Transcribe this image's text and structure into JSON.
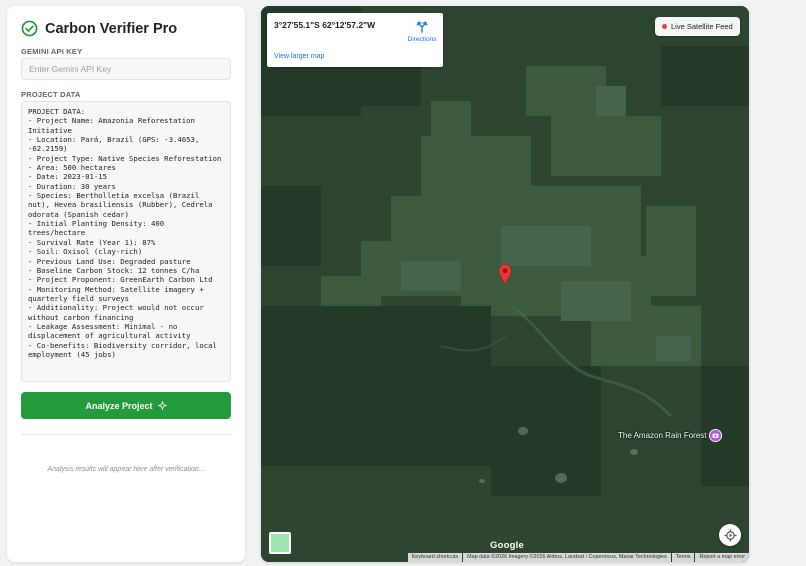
{
  "app": {
    "title": "Carbon Verifier Pro",
    "icon": "check-circle-icon",
    "accent": "#239a3b"
  },
  "api_key": {
    "label": "GEMINI API KEY",
    "value": "",
    "placeholder": "Enter Gemini API Key"
  },
  "project_data": {
    "label": "PROJECT DATA",
    "text": "PROJECT DATA:\n- Project Name: Amazonia Reforestation Initiative\n- Location: Pará, Brazil (GPS: -3.4653, -62.2159)\n- Project Type: Native Species Reforestation\n- Area: 500 hectares\n- Date: 2023-01-15\n- Duration: 30 years\n- Species: Bertholletia excelsa (Brazil nut), Hevea brasiliensis (Rubber), Cedrela odorata (Spanish cedar)\n- Initial Planting Density: 400 trees/hectare\n- Survival Rate (Year 1): 87%\n- Soil: Oxisol (clay-rich)\n- Previous Land Use: Degraded pasture\n- Baseline Carbon Stock: 12 tonnes C/ha\n- Project Proponent: GreenEarth Carbon Ltd\n- Monitoring Method: Satellite imagery + quarterly field surveys\n- Additionality: Project would not occur without carbon financing\n- Leakage Assessment: Minimal - no displacement of agricultural activity\n- Co-benefits: Biodiversity corridor, local employment (45 jobs)"
  },
  "analyze_button": {
    "label": "Analyze Project",
    "icon": "sparkle-icon"
  },
  "results": {
    "placeholder": "Analysis results will appear here after verification..."
  },
  "map": {
    "coordinates": "3°27'55.1\"S 62°12'57.2\"W",
    "directions_label": "Directions",
    "larger_map_label": "View larger map",
    "live_feed_label": "Live Satellite Feed",
    "live_feed_color": "#e0443a",
    "place_label": "The Amazon Rain Forest",
    "place_icon": "camera-pin-icon",
    "marker_color": "#e53935",
    "logo": "Google",
    "attribution": {
      "shortcuts": "Keyboard shortcuts",
      "data": "Map data ©2026 Imagery ©2026 Airbus, Landsat / Copernicus, Maxar Technologies",
      "terms": "Terms",
      "report": "Report a map error"
    }
  }
}
